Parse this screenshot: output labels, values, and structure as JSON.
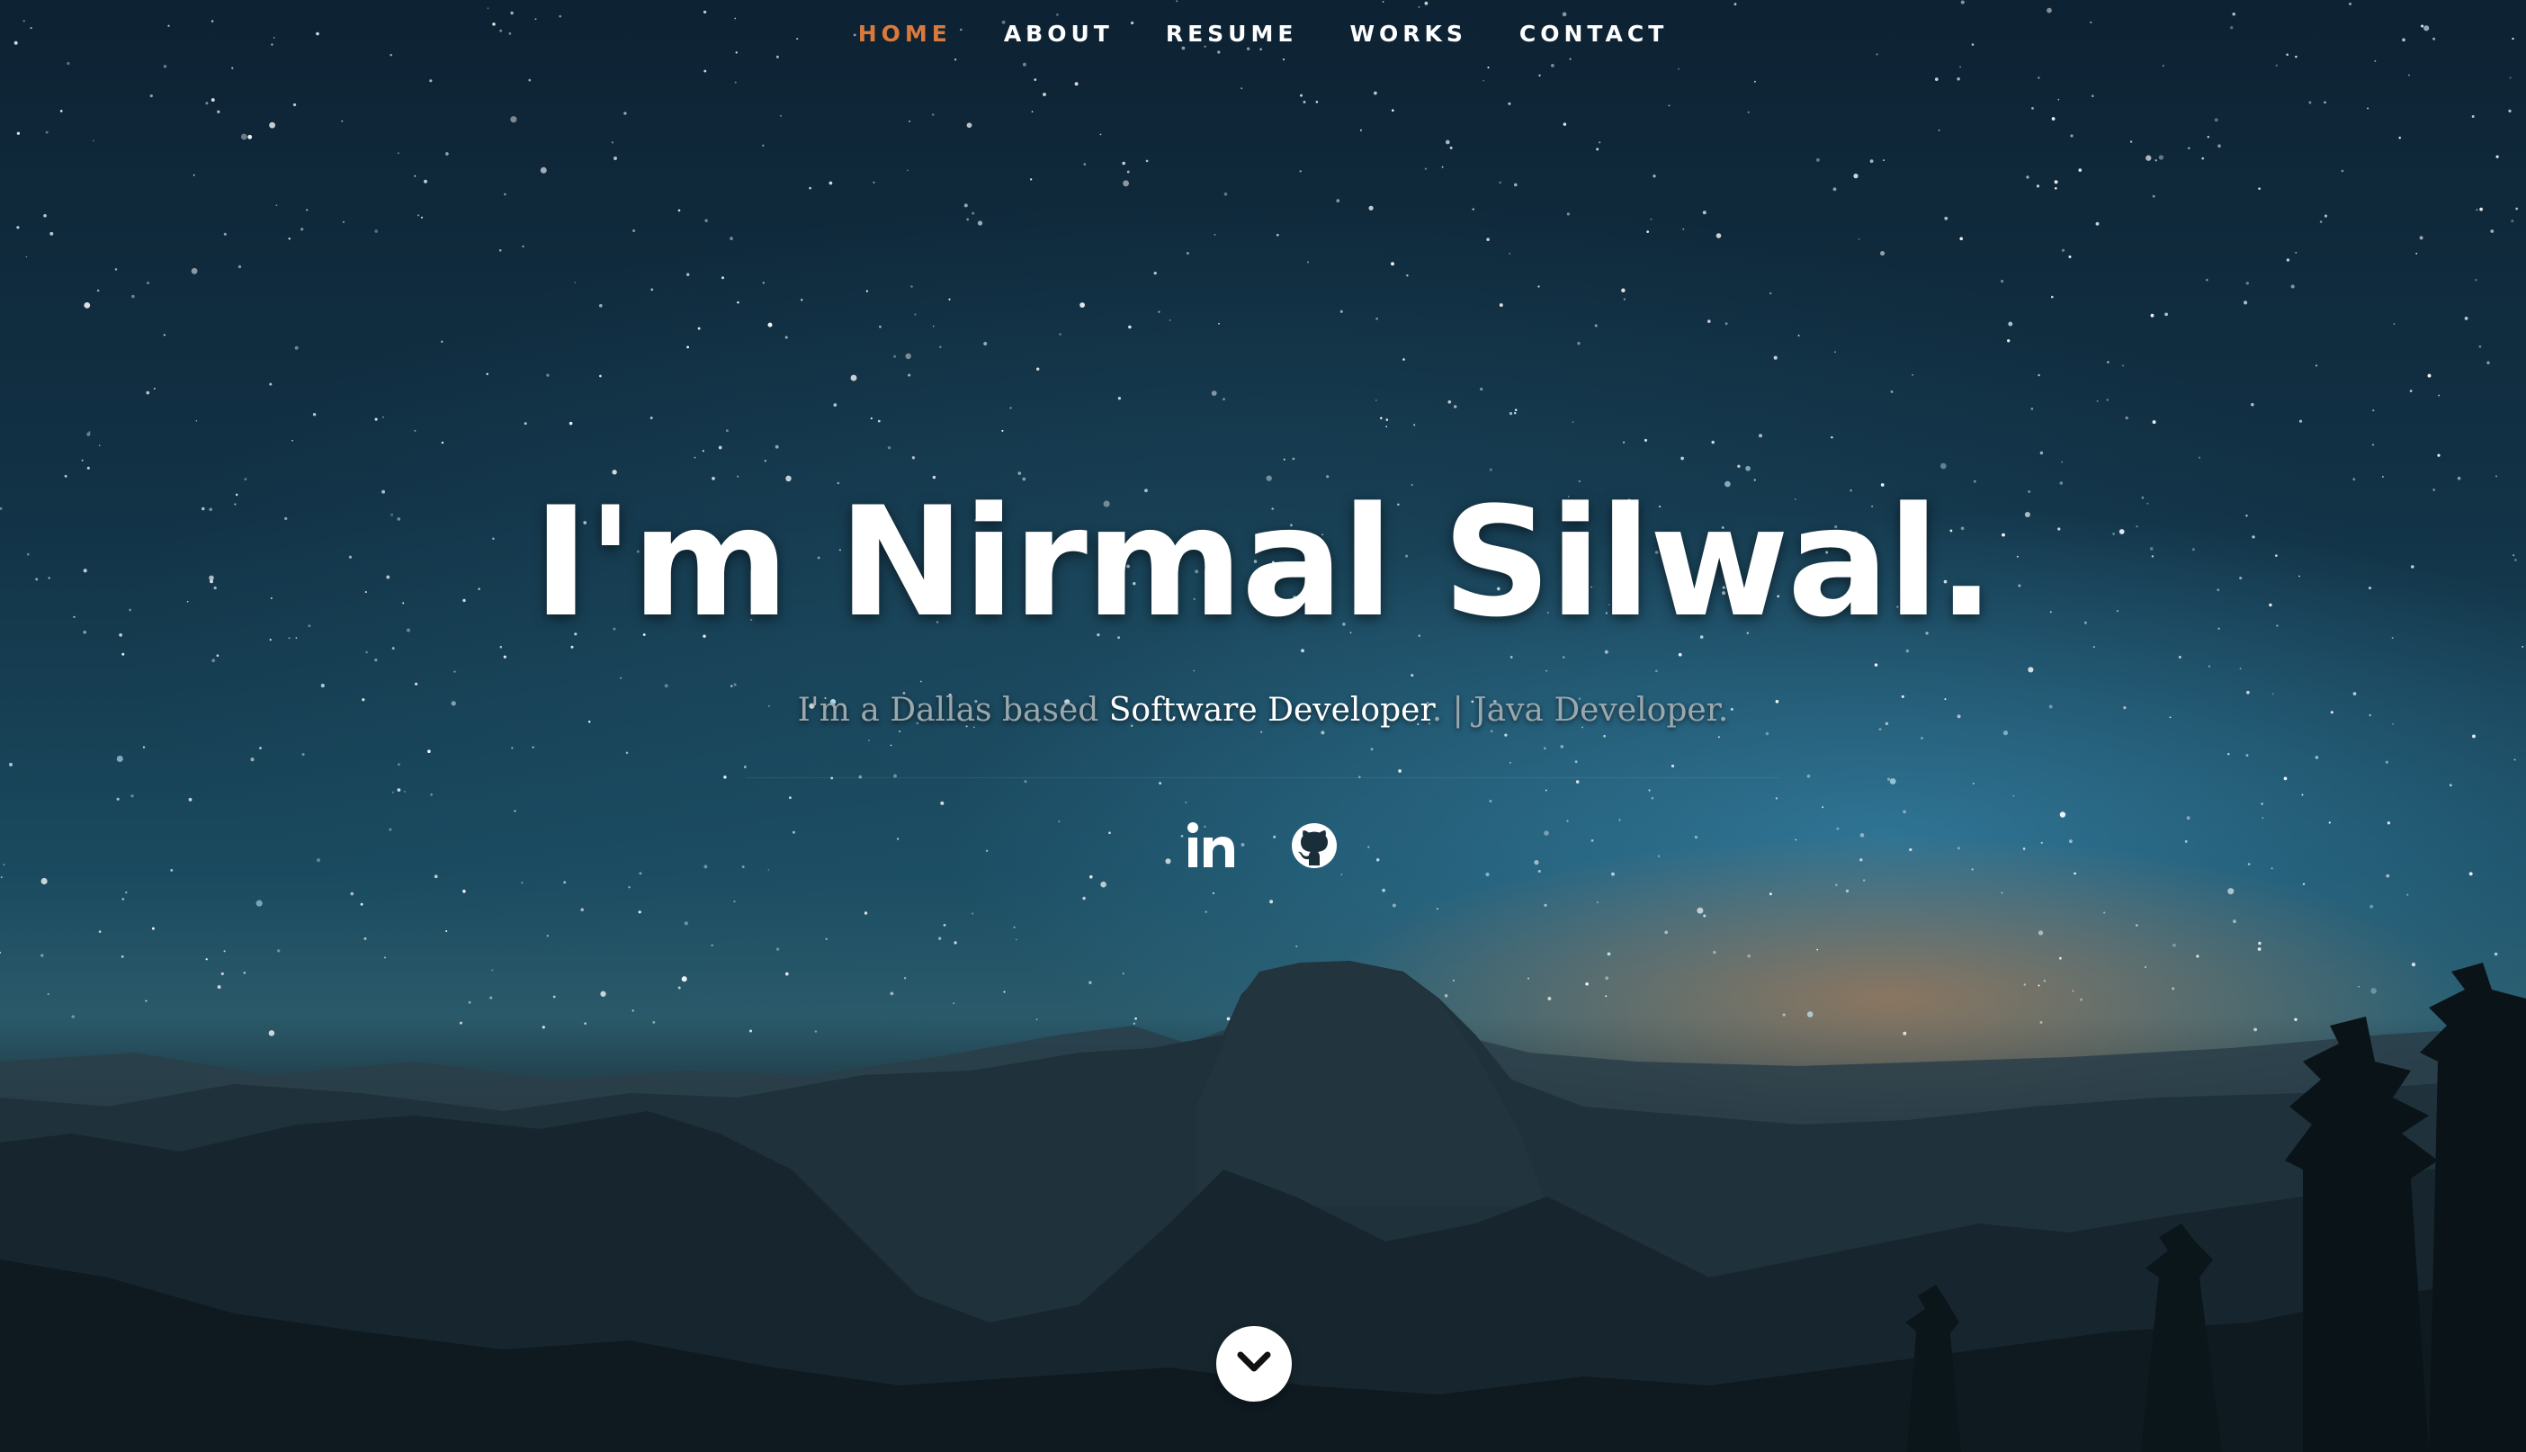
{
  "nav": {
    "items": [
      {
        "label": "HOME",
        "active": true
      },
      {
        "label": "ABOUT",
        "active": false
      },
      {
        "label": "RESUME",
        "active": false
      },
      {
        "label": "WORKS",
        "active": false
      },
      {
        "label": "CONTACT",
        "active": false
      }
    ],
    "active_color": "#d9793b"
  },
  "hero": {
    "headline": "I'm Nirmal Silwal.",
    "tagline": {
      "prefix": "I'm a Dallas based ",
      "role": "Software Developer",
      "suffix": ". | Java Developer."
    }
  },
  "social": {
    "icons": [
      "linkedin-icon",
      "github-icon"
    ]
  },
  "scroll": {
    "icon": "chevron-down-icon"
  }
}
